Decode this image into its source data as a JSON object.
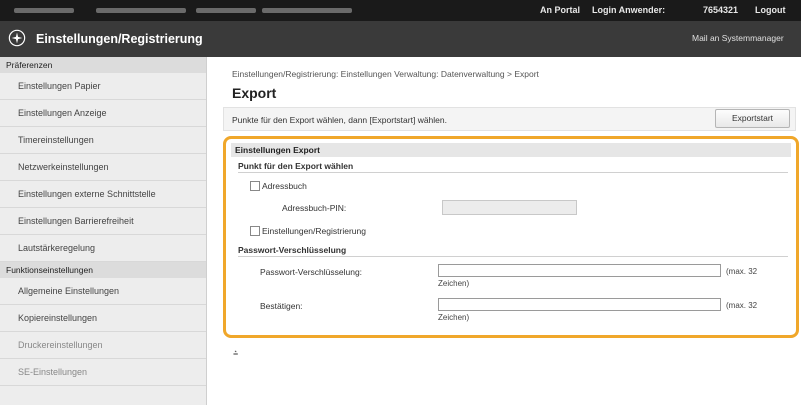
{
  "topbar": {
    "portal": "An Portal",
    "login_label": "Login Anwender:",
    "login_value": "7654321",
    "logout": "Logout"
  },
  "header": {
    "title": "Einstellungen/Registrierung",
    "mail": "Mail an Systemmanager"
  },
  "sidebar": {
    "section1": "Präferenzen",
    "items1": [
      "Einstellungen Papier",
      "Einstellungen Anzeige",
      "Timereinstellungen",
      "Netzwerkeinstellungen",
      "Einstellungen externe Schnittstelle",
      "Einstellungen Barrierefreiheit",
      "Lautstärkeregelung"
    ],
    "section2": "Funktionseinstellungen",
    "items2": [
      "Allgemeine Einstellungen",
      "Kopiereinstellungen",
      "Druckereinstellungen",
      "SE-Einstellungen"
    ]
  },
  "main": {
    "breadcrumb": "Einstellungen/Registrierung: Einstellungen Verwaltung: Datenverwaltung > Export",
    "page_title": "Export",
    "instruction": "Punkte für den Export wählen, dann [Exportstart] wählen.",
    "export_button": "Exportstart",
    "panel_title": "Einstellungen Export",
    "section_items": "Punkt für den Export wählen",
    "addressbook": "Adressbuch",
    "addressbook_pin": "Adressbuch-PIN:",
    "settings_reg": "Einstellungen/Registrierung",
    "section_pw": "Passwort-Verschlüsselung",
    "pw_label": "Passwort-Verschlüsselung:",
    "pw_hint_a": "(max. 32",
    "pw_hint_b": "Zeichen)",
    "confirm_label": "Bestätigen:",
    "confirm_hint_a": "(max. 32",
    "confirm_hint_b": "Zeichen)",
    "back_to_top": "⩮"
  }
}
